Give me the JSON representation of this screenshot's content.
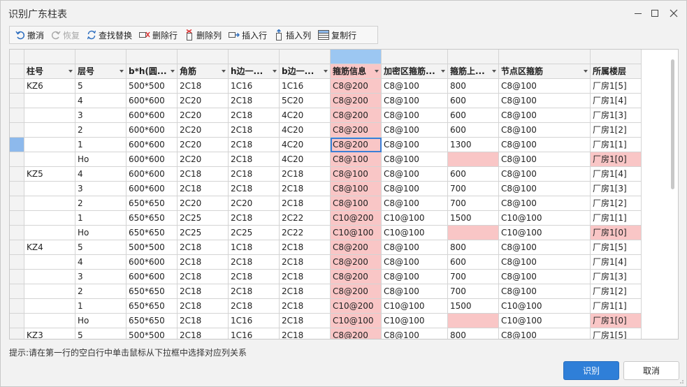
{
  "window": {
    "title": "识别广东柱表"
  },
  "toolbar": {
    "undo": "撤消",
    "redo": "恢复",
    "find_replace": "查找替换",
    "delete_row": "删除行",
    "delete_col": "删除列",
    "insert_row": "插入行",
    "insert_col": "插入列",
    "copy_row": "复制行"
  },
  "table": {
    "headers": [
      "柱号",
      "层号",
      "b*h(圆...",
      "角筋",
      "h边一...",
      "b边一...",
      "箍筋信息",
      "加密区箍筋...",
      "箍筋上...",
      "节点区箍筋",
      "所属楼层"
    ],
    "rows": [
      [
        "KZ6",
        "5",
        "500*500",
        "2C18",
        "1C16",
        "1C16",
        "C8@200",
        "C8@100",
        "800",
        "C8@100",
        "厂房1[5]"
      ],
      [
        "",
        "4",
        "600*600",
        "2C20",
        "2C18",
        "5C20",
        "C8@200",
        "C8@100",
        "600",
        "C8@100",
        "厂房1[4]"
      ],
      [
        "",
        "3",
        "600*600",
        "2C20",
        "2C18",
        "4C20",
        "C8@200",
        "C8@100",
        "600",
        "C8@100",
        "厂房1[3]"
      ],
      [
        "",
        "2",
        "600*600",
        "2C20",
        "2C18",
        "4C20",
        "C8@200",
        "C8@100",
        "600",
        "C8@100",
        "厂房1[2]"
      ],
      [
        "",
        "1",
        "600*600",
        "2C20",
        "2C18",
        "4C20",
        "C8@200",
        "C8@100",
        "1300",
        "C8@100",
        "厂房1[1]"
      ],
      [
        "",
        "Ho",
        "600*600",
        "2C20",
        "2C18",
        "4C20",
        "C8@100",
        "C8@100",
        "",
        "C8@100",
        "厂房1[0]"
      ],
      [
        "KZ5",
        "4",
        "600*600",
        "2C18",
        "2C18",
        "2C18",
        "C8@100",
        "C8@100",
        "600",
        "C8@100",
        "厂房1[4]"
      ],
      [
        "",
        "3",
        "600*600",
        "2C18",
        "2C18",
        "2C18",
        "C8@100",
        "C8@100",
        "700",
        "C8@100",
        "厂房1[3]"
      ],
      [
        "",
        "2",
        "650*650",
        "2C20",
        "2C20",
        "2C18",
        "C8@100",
        "C8@100",
        "700",
        "C8@100",
        "厂房1[2]"
      ],
      [
        "",
        "1",
        "650*650",
        "2C25",
        "2C18",
        "2C22",
        "C10@200",
        "C10@100",
        "1500",
        "C10@100",
        "厂房1[1]"
      ],
      [
        "",
        "Ho",
        "650*650",
        "2C25",
        "2C25",
        "2C22",
        "C10@100",
        "C10@100",
        "",
        "C10@100",
        "厂房1[0]"
      ],
      [
        "KZ4",
        "5",
        "500*500",
        "2C18",
        "1C18",
        "2C18",
        "C8@200",
        "C8@100",
        "800",
        "C8@100",
        "厂房1[5]"
      ],
      [
        "",
        "4",
        "600*600",
        "2C18",
        "2C18",
        "2C18",
        "C8@200",
        "C8@100",
        "600",
        "C8@100",
        "厂房1[4]"
      ],
      [
        "",
        "3",
        "600*600",
        "2C18",
        "2C18",
        "2C18",
        "C8@200",
        "C8@100",
        "700",
        "C8@100",
        "厂房1[3]"
      ],
      [
        "",
        "2",
        "650*650",
        "2C18",
        "2C18",
        "2C18",
        "C8@200",
        "C8@100",
        "700",
        "C8@100",
        "厂房1[2]"
      ],
      [
        "",
        "1",
        "650*650",
        "2C18",
        "2C18",
        "2C18",
        "C10@200",
        "C10@100",
        "1500",
        "C10@100",
        "厂房1[1]"
      ],
      [
        "",
        "Ho",
        "650*650",
        "2C18",
        "1C16",
        "2C18",
        "C10@100",
        "C10@100",
        "",
        "C10@100",
        "厂房1[0]"
      ],
      [
        "KZ3",
        "5",
        "500*500",
        "2C18",
        "1C16",
        "2C18",
        "C8@200",
        "C8@100",
        "800",
        "C8@100",
        "厂房1[5]"
      ]
    ]
  },
  "hint": "提示:请在第一行的空白行中单击鼠标从下拉框中选择对应列关系",
  "buttons": {
    "recognize": "识别",
    "cancel": "取消"
  },
  "colors": {
    "highlight_pink": "#f9c6c6",
    "selected_blue": "#9cc7f2",
    "primary": "#2f7fd8"
  }
}
